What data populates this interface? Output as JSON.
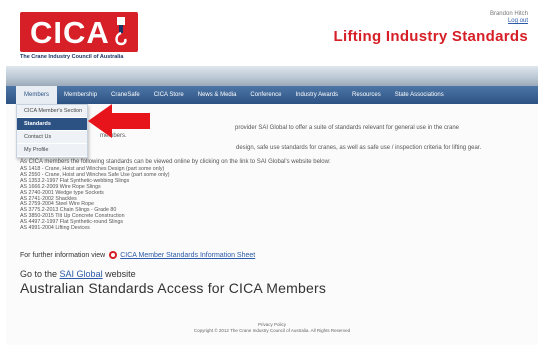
{
  "header": {
    "logo_text": "CICA",
    "logo_subtitle": "The Crane Industry Council of Australia",
    "user_name": "Brandon Hitch",
    "logout_label": "Log out",
    "site_title": "Lifting Industry Standards"
  },
  "nav": {
    "items": [
      {
        "label": "Members",
        "active": true
      },
      {
        "label": "Membership"
      },
      {
        "label": "CraneSafe"
      },
      {
        "label": "CICA Store"
      },
      {
        "label": "News & Media"
      },
      {
        "label": "Conference"
      },
      {
        "label": "Industry Awards"
      },
      {
        "label": "Resources"
      },
      {
        "label": "State Associations"
      }
    ]
  },
  "dropdown": {
    "items": [
      {
        "label": "CICA Member's Section"
      },
      {
        "label": "Standards",
        "selected": true
      },
      {
        "label": "Contact Us"
      },
      {
        "label": "My Profile"
      }
    ]
  },
  "content": {
    "intro_line1": "provider SAI Global to offer a suite of standards relevant for general use in the crane",
    "intro_line1b": "members.",
    "intro_line2": "design, safe use standards for cranes, as well as safe use / inspection criteria for lifting gear.",
    "lead": "As CICA members the following standards can be viewed online by clicking on the link to SAI Global's website below:",
    "standards": [
      "AS 1418 - Crane, Hoist and Winches Design (part some only)",
      "AS 2550 - Crane, Hoist and Winches Safe Use (part some only)",
      "AS 1353.2-1997 Flat Synthetic-webbing Slings",
      "AS 1666.2-2009 Wire Rope Slings",
      "AS 2740-2001 Wedge type Sockets",
      "AS 2741-2002 Shackles",
      "AS 2759-2004 Steel Wire Rope",
      "AS 3775.2-2013 Chain Slings - Grade 80",
      "AS 3850-2015 Tilt Up Concrete Construction",
      "AS 4497.2-1997 Flat Synthetic-round Slings",
      "AS 4991-2004 Lifting Devices"
    ],
    "further_prefix": "For further information view",
    "further_link": "CICA Member Standards Information Sheet",
    "goto_prefix": "Go to the",
    "goto_link": "SAI Global",
    "goto_suffix": "website",
    "big_heading": "Australian Standards Access for CICA Members"
  },
  "footer": {
    "privacy": "Privacy Policy",
    "copyright": "Copyright © 2012 The Crane Industry Council of Australia. All Rights Reserved"
  },
  "colors": {
    "brand_red": "#d61f26",
    "nav_blue": "#2c5283",
    "link_blue": "#2a5aa8"
  }
}
